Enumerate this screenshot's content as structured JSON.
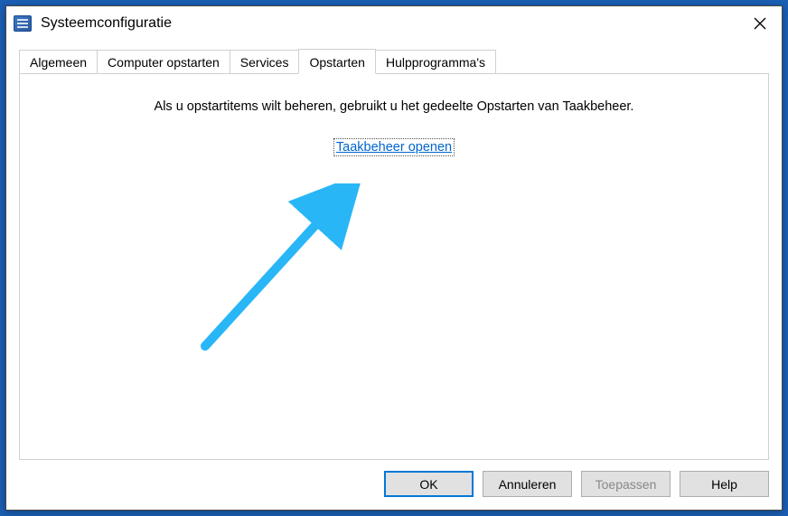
{
  "window": {
    "title": "Systeemconfiguratie"
  },
  "tabs": [
    {
      "label": "Algemeen"
    },
    {
      "label": "Computer opstarten"
    },
    {
      "label": "Services"
    },
    {
      "label": "Opstarten"
    },
    {
      "label": "Hulpprogramma's"
    }
  ],
  "panel": {
    "message": "Als u opstartitems wilt beheren, gebruikt u het gedeelte Opstarten van Taakbeheer.",
    "link_label": "Taakbeheer openen"
  },
  "buttons": {
    "ok": "OK",
    "cancel": "Annuleren",
    "apply": "Toepassen",
    "help": "Help"
  }
}
